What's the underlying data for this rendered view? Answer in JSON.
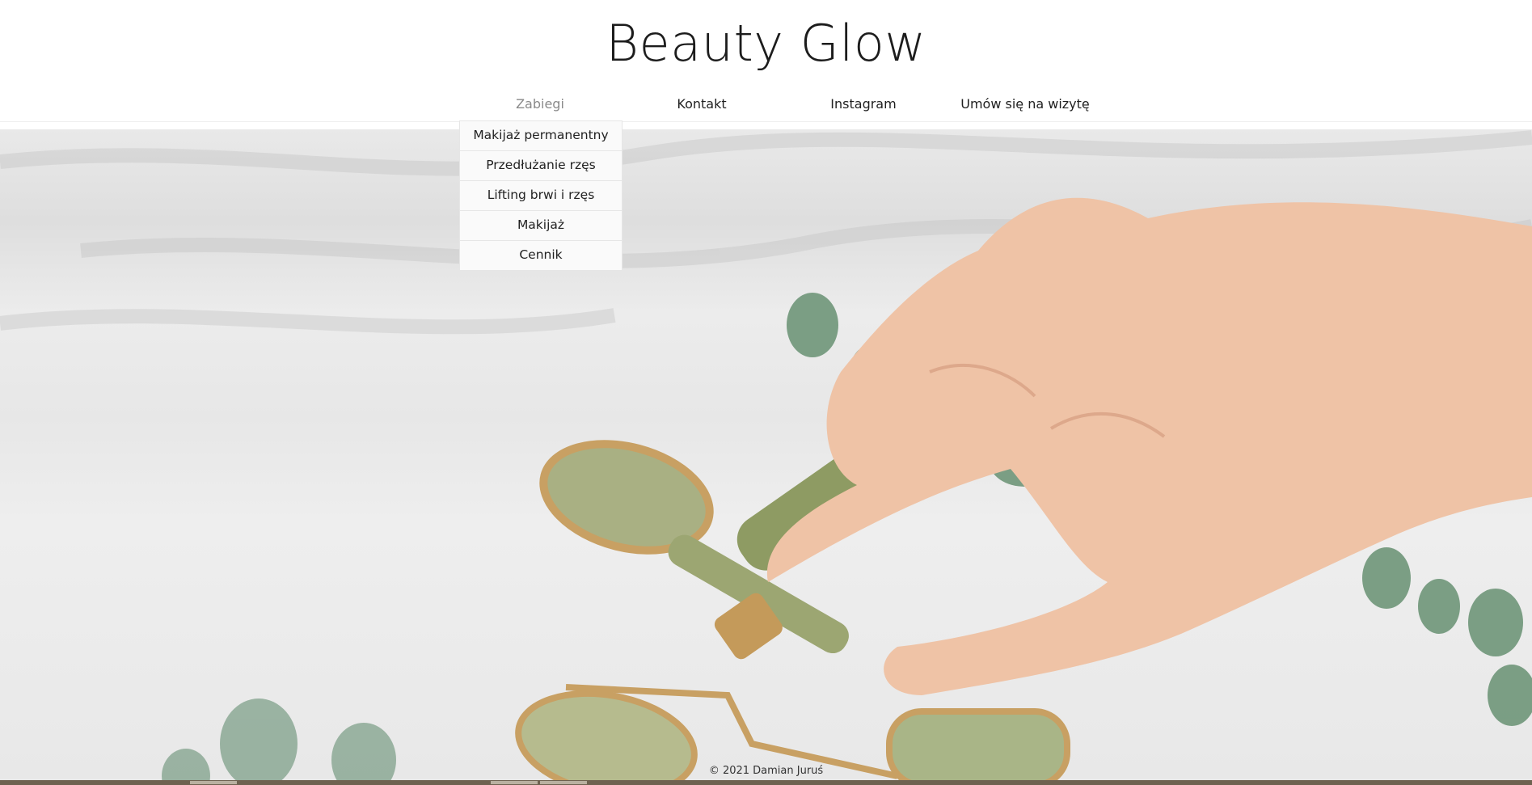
{
  "site": {
    "title": "Beauty Glow"
  },
  "nav": {
    "items": [
      {
        "label": "Zabiegi",
        "active": true
      },
      {
        "label": "Kontakt",
        "active": false
      },
      {
        "label": "Instagram",
        "active": false
      },
      {
        "label": "Umów się na wizytę",
        "active": false
      }
    ]
  },
  "dropdown": {
    "items": [
      {
        "label": "Makijaż permanentny"
      },
      {
        "label": "Przedłużanie rzęs"
      },
      {
        "label": "Lifting brwi i rzęs"
      },
      {
        "label": "Makijaż"
      },
      {
        "label": "Cennik"
      }
    ]
  },
  "footer": {
    "copyright": "© 2021 Damian Juruś"
  },
  "colors": {
    "text": "#1c1c1c",
    "nav_active": "#8a8a8a",
    "dropdown_bg": "#fafafa",
    "hero_bg": "#e8e8e8",
    "jade": "#a3ad7c",
    "gold": "#c8a063",
    "skin": "#efc3a6",
    "leaf": "#6f9679"
  }
}
